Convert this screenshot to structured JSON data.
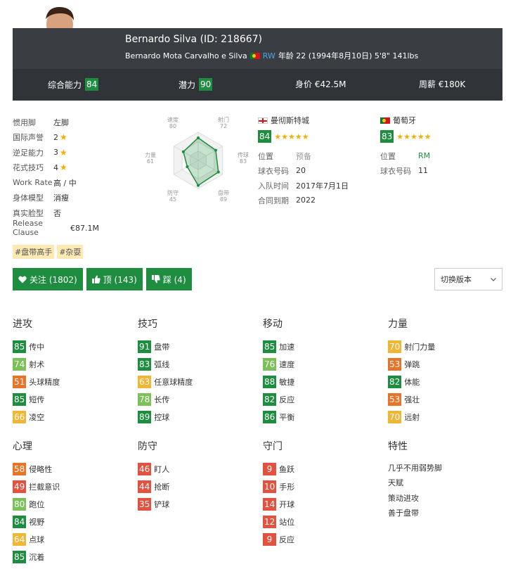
{
  "player": {
    "name_line": "Bernardo Silva (ID: 218667)",
    "full_name": "Bernardo Mota Carvalho e Silva",
    "position": "RW",
    "details": "年龄 22 (1994年8月10日) 5'8\" 141lbs"
  },
  "stats": {
    "overall_label": "综合能力",
    "overall": "84",
    "potential_label": "潜力",
    "potential": "90",
    "value": "身价 €42.5M",
    "wage": "周薪 €180K"
  },
  "info": [
    {
      "label": "惯用脚",
      "value": "左脚"
    },
    {
      "label": "国际声誉",
      "value": "2",
      "star": "★"
    },
    {
      "label": "逆足能力",
      "value": "3",
      "star": "★"
    },
    {
      "label": "花式技巧",
      "value": "4",
      "star": "★"
    },
    {
      "label": "Work Rate",
      "value": "高 / 中"
    },
    {
      "label": "身体模型",
      "value": "消瘦"
    },
    {
      "label": "真实脸型",
      "value": "否"
    },
    {
      "label": "Release Clause",
      "value": "€87.1M"
    }
  ],
  "radar": {
    "labels": [
      "速度",
      "射门",
      "传球",
      "盘带",
      "防守",
      "力量"
    ],
    "values": [
      "80",
      "72",
      "83",
      "89",
      "45",
      "61"
    ]
  },
  "club": {
    "name": "曼彻斯特城",
    "rating": "84",
    "stars": "★★★★★",
    "rows": [
      {
        "k": "位置",
        "v": "预备"
      },
      {
        "k": "球衣号码",
        "v": "20"
      },
      {
        "k": "入队时间",
        "v": "2017年7月1日"
      },
      {
        "k": "合同到期",
        "v": "2022"
      }
    ]
  },
  "nation": {
    "name": "葡萄牙",
    "rating": "83",
    "stars": "★★★★★",
    "rows": [
      {
        "k": "位置",
        "v": "RM"
      },
      {
        "k": "球衣号码",
        "v": "11"
      }
    ]
  },
  "tags": [
    "#盘带高手",
    "#杂耍"
  ],
  "actions": {
    "follow": "关注 (1802)",
    "up": "顶 (143)",
    "down": "踩 (4)",
    "version": "切换版本"
  },
  "sections": {
    "attack": {
      "title": "进攻",
      "items": [
        {
          "v": "85",
          "n": "传中",
          "c": "g-dark"
        },
        {
          "v": "74",
          "n": "射术",
          "c": "g-light"
        },
        {
          "v": "51",
          "n": "头球精度",
          "c": "o"
        },
        {
          "v": "85",
          "n": "短传",
          "c": "g-dark"
        },
        {
          "v": "66",
          "n": "凌空",
          "c": "y"
        }
      ]
    },
    "skill": {
      "title": "技巧",
      "items": [
        {
          "v": "91",
          "n": "盘带",
          "c": "g-dark"
        },
        {
          "v": "83",
          "n": "弧线",
          "c": "g-dark"
        },
        {
          "v": "63",
          "n": "任意球精度",
          "c": "y"
        },
        {
          "v": "78",
          "n": "长传",
          "c": "g-light"
        },
        {
          "v": "89",
          "n": "控球",
          "c": "g-dark"
        }
      ]
    },
    "movement": {
      "title": "移动",
      "items": [
        {
          "v": "85",
          "n": "加速",
          "c": "g-dark"
        },
        {
          "v": "76",
          "n": "速度",
          "c": "g-light"
        },
        {
          "v": "88",
          "n": "敏捷",
          "c": "g-dark"
        },
        {
          "v": "82",
          "n": "反应",
          "c": "g-dark"
        },
        {
          "v": "86",
          "n": "平衡",
          "c": "g-dark"
        }
      ]
    },
    "power": {
      "title": "力量",
      "items": [
        {
          "v": "70",
          "n": "射门力量",
          "c": "y"
        },
        {
          "v": "53",
          "n": "弹跳",
          "c": "o"
        },
        {
          "v": "82",
          "n": "体能",
          "c": "g-dark"
        },
        {
          "v": "53",
          "n": "强壮",
          "c": "o"
        },
        {
          "v": "70",
          "n": "远射",
          "c": "y"
        }
      ]
    },
    "mentality": {
      "title": "心理",
      "items": [
        {
          "v": "58",
          "n": "侵略性",
          "c": "o"
        },
        {
          "v": "49",
          "n": "拦截意识",
          "c": "r"
        },
        {
          "v": "80",
          "n": "跑位",
          "c": "g-light"
        },
        {
          "v": "84",
          "n": "视野",
          "c": "g-dark"
        },
        {
          "v": "64",
          "n": "点球",
          "c": "y"
        },
        {
          "v": "85",
          "n": "沉着",
          "c": "g-dark"
        }
      ]
    },
    "defending": {
      "title": "防守",
      "items": [
        {
          "v": "46",
          "n": "盯人",
          "c": "r"
        },
        {
          "v": "44",
          "n": "抢断",
          "c": "r"
        },
        {
          "v": "35",
          "n": "铲球",
          "c": "r"
        }
      ]
    },
    "goalkeeping": {
      "title": "守门",
      "items": [
        {
          "v": "9",
          "n": "鱼跃",
          "c": "r"
        },
        {
          "v": "10",
          "n": "手形",
          "c": "r"
        },
        {
          "v": "14",
          "n": "开球",
          "c": "r"
        },
        {
          "v": "12",
          "n": "站位",
          "c": "r"
        },
        {
          "v": "9",
          "n": "反应",
          "c": "r"
        }
      ]
    },
    "traits": {
      "title": "特性",
      "items": [
        "几乎不用弱势脚",
        "天赋",
        "策动进攻",
        "善于盘带"
      ]
    }
  }
}
